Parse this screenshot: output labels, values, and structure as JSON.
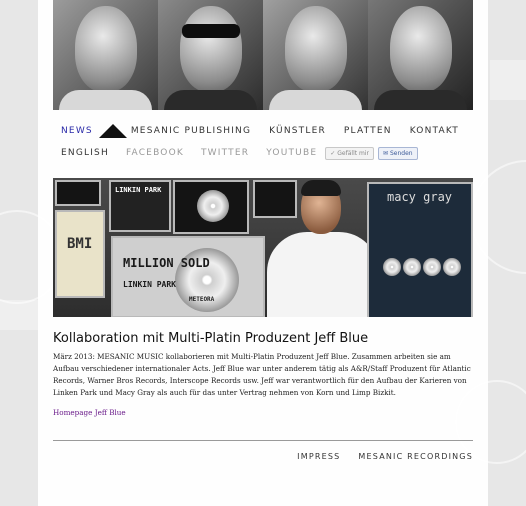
{
  "hero": {
    "faces": [
      "member-1",
      "member-2",
      "member-3",
      "member-4"
    ]
  },
  "nav": {
    "news": "NEWS",
    "publishing": "MESANIC PUBLISHING",
    "kuenstler": "KÜNSTLER",
    "platten": "PLATTEN",
    "kontakt": "KONTAKT",
    "logo_icon": "triangle-logo"
  },
  "subnav": {
    "english": "ENGLISH",
    "facebook": "FACEBOOK",
    "twitter": "TWITTER",
    "youtube": "YOUTUBE",
    "like_label": "Gefällt mir",
    "send_label": "Senden"
  },
  "feature_image": {
    "texts": {
      "linkin_park_top": "LINKIN PARK",
      "bmi": "BMI",
      "million_sold": "MILLION SOLD",
      "linkin_park_bottom": "LINKIN PARK",
      "meteora": "METEORA",
      "macy_gray": "macy gray"
    }
  },
  "article": {
    "title": "Kollaboration mit Multi-Platin Produzent Jeff Blue",
    "body": "März 2013: MESANIC MUSIC kollaborieren mit Multi-Platin Produzent Jeff Blue. Zusammen arbeiten sie am Aufbau verschiedener internationaler Acts. Jeff Blue war unter anderem tätig als A&R/Staff Produzent für Atlantic Records, Warner Bros Records, Interscope Records usw. Jeff war verantwortlich für den Aufbau der Karieren von Linken Park und Macy Gray als auch für das unter Vertrag nehmen von Korn und Limp Bizkit.",
    "link": "Homepage Jeff Blue"
  },
  "footer": {
    "impress": "IMPRESS",
    "recordings": "MESANIC RECORDINGS"
  },
  "colors": {
    "active_nav": "#2a2aa8",
    "link": "#6a1b8a",
    "background": "#e7e7e7"
  }
}
